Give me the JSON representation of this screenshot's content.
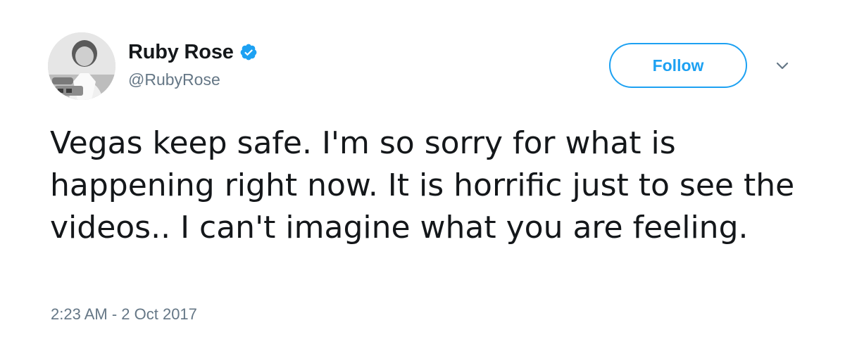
{
  "tweet": {
    "author": {
      "display_name": "Ruby Rose",
      "handle": "@RubyRose",
      "verified": true,
      "avatar_icon": "profile-photo"
    },
    "follow_label": "Follow",
    "menu_icon": "chevron-down-icon",
    "text": "Vegas keep safe. I'm so sorry for what is happening right now. It is horrific just to see the videos.. I can't imagine what you are feeling.",
    "timestamp": "2:23 AM - 2 Oct 2017"
  },
  "colors": {
    "accent": "#1da1f2",
    "text": "#14171a",
    "muted": "#657786"
  }
}
